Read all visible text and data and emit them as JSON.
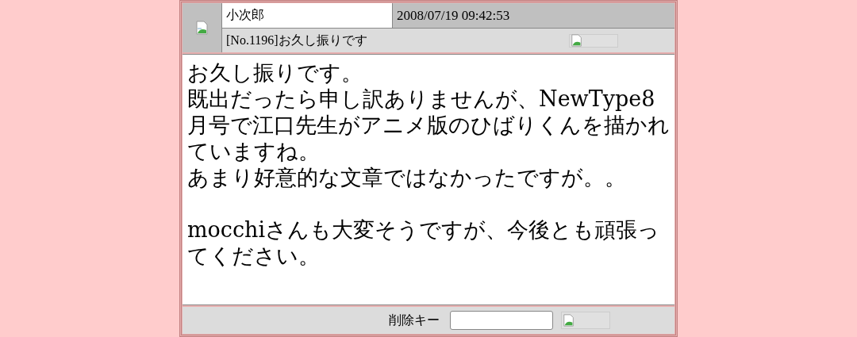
{
  "post": {
    "author": "小次郎",
    "date": "2008/07/19 09:42:53",
    "subject": "[No.1196]お久し振りです",
    "body": [
      [
        "お久し振りです。",
        "既出だったら申し訳ありませんが、NewType8月号で江口先生がアニメ版のひばりくんを描かれていますね。",
        "あまり好意的な文章ではなかったですが。。"
      ],
      [
        "mocchiさんも大変そうですが、今後とも頑張ってください。"
      ]
    ],
    "delete_key": {
      "label": "削除キー"
    }
  }
}
